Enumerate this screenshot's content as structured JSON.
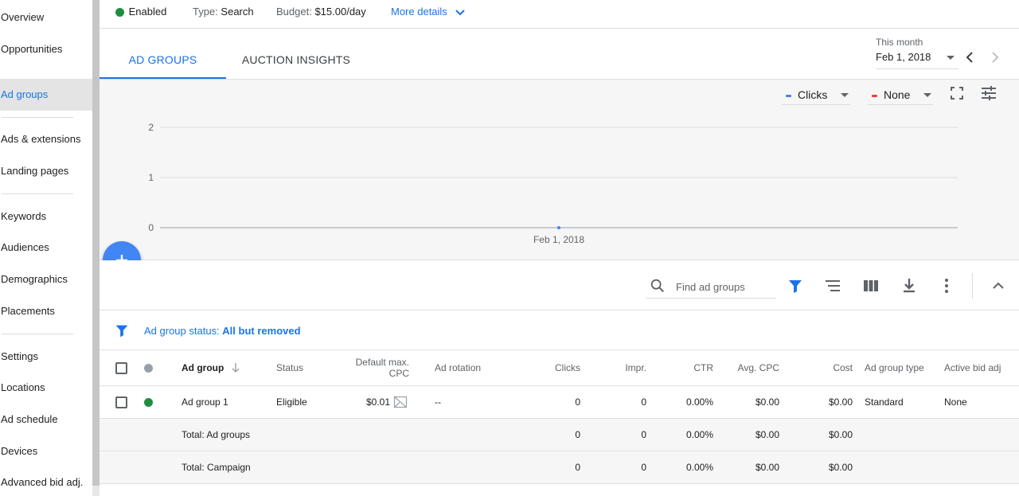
{
  "sidebar": {
    "items": [
      {
        "label": "Overview",
        "active": false
      },
      {
        "label": "Opportunities",
        "active": false
      },
      {
        "label": "Ad groups",
        "active": true
      },
      {
        "label": "Ads & extensions",
        "active": false
      },
      {
        "label": "Landing pages",
        "active": false
      },
      {
        "label": "Keywords",
        "active": false
      },
      {
        "label": "Audiences",
        "active": false
      },
      {
        "label": "Demographics",
        "active": false
      },
      {
        "label": "Placements",
        "active": false
      },
      {
        "label": "Settings",
        "active": false
      },
      {
        "label": "Locations",
        "active": false
      },
      {
        "label": "Ad schedule",
        "active": false
      },
      {
        "label": "Devices",
        "active": false
      },
      {
        "label": "Advanced bid adj.",
        "active": false
      }
    ]
  },
  "status_bar": {
    "status": "Enabled",
    "status_color": "#1e8e3e",
    "type_label": "Type:",
    "type_value": "Search",
    "budget_label": "Budget:",
    "budget_value": "$15.00/day",
    "more_details": "More details"
  },
  "tabs": [
    {
      "label": "AD GROUPS",
      "active": true
    },
    {
      "label": "AUCTION INSIGHTS",
      "active": false
    }
  ],
  "date_range": {
    "caption": "This month",
    "value": "Feb 1, 2018"
  },
  "chart_controls": {
    "metric1": {
      "label": "Clicks",
      "color": "#4285f4"
    },
    "metric2": {
      "label": "None",
      "color": "#ea4335"
    }
  },
  "chart_data": {
    "type": "line",
    "x": [
      "Feb 1, 2018"
    ],
    "series": [
      {
        "name": "Clicks",
        "values": [
          0
        ]
      }
    ],
    "yticks": [
      0,
      1,
      2
    ],
    "ylim": [
      0,
      2
    ],
    "xlabel": "",
    "ylabel": "",
    "grid": true
  },
  "toolbar": {
    "search_placeholder": "Find ad groups"
  },
  "filter": {
    "label": "Ad group status:",
    "value": "All but removed"
  },
  "table": {
    "headers": {
      "ad_group": "Ad group",
      "status": "Status",
      "default_cpc_line1": "Default max.",
      "default_cpc_line2": "CPC",
      "ad_rotation": "Ad rotation",
      "clicks": "Clicks",
      "impr": "Impr.",
      "ctr": "CTR",
      "avg_cpc": "Avg. CPC",
      "cost": "Cost",
      "ad_group_type": "Ad group type",
      "active_bid_adj": "Active bid adj"
    },
    "rows": [
      {
        "name": "Ad group 1",
        "status": "Eligible",
        "default_cpc": "$0.01",
        "ad_rotation": "--",
        "clicks": "0",
        "impr": "0",
        "ctr": "0.00%",
        "avg_cpc": "$0.00",
        "cost": "$0.00",
        "ad_group_type": "Standard",
        "active_bid_adj": "None"
      }
    ],
    "totals": [
      {
        "label": "Total: Ad groups",
        "clicks": "0",
        "impr": "0",
        "ctr": "0.00%",
        "avg_cpc": "$0.00",
        "cost": "$0.00"
      },
      {
        "label": "Total: Campaign",
        "clicks": "0",
        "impr": "0",
        "ctr": "0.00%",
        "avg_cpc": "$0.00",
        "cost": "$0.00"
      }
    ]
  }
}
